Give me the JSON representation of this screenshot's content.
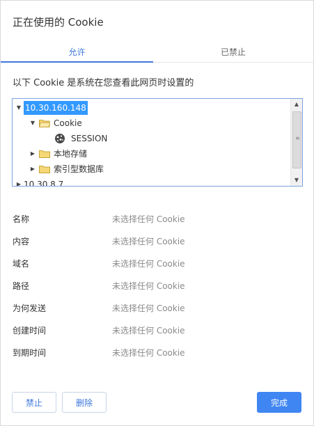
{
  "dialog": {
    "title": "正在使用的 Cookie",
    "tabs": [
      {
        "label": "允许",
        "active": true
      },
      {
        "label": "已禁止",
        "active": false
      }
    ],
    "description": "以下 Cookie 是系统在您查看此网页时设置的",
    "tree": {
      "nodes": [
        {
          "label": "10.30.160.148",
          "expanded": true,
          "selected": true,
          "icon": "none"
        },
        {
          "label": "Cookie",
          "expanded": true,
          "icon": "folder-open-icon"
        },
        {
          "label": "SESSION",
          "icon": "cookie-icon"
        },
        {
          "label": "本地存储",
          "expanded": false,
          "icon": "folder-icon"
        },
        {
          "label": "索引型数据库",
          "expanded": false,
          "icon": "folder-icon"
        },
        {
          "label": "10.30.8.7",
          "expanded": false,
          "icon": "none"
        }
      ]
    },
    "details": [
      {
        "key": "名称",
        "value": "未选择任何 Cookie"
      },
      {
        "key": "内容",
        "value": "未选择任何 Cookie"
      },
      {
        "key": "域名",
        "value": "未选择任何 Cookie"
      },
      {
        "key": "路径",
        "value": "未选择任何 Cookie"
      },
      {
        "key": "为何发送",
        "value": "未选择任何 Cookie"
      },
      {
        "key": "创建时间",
        "value": "未选择任何 Cookie"
      },
      {
        "key": "到期时间",
        "value": "未选择任何 Cookie"
      }
    ],
    "buttons": {
      "block": "禁止",
      "delete": "删除",
      "done": "完成"
    },
    "colors": {
      "accent": "#3f78dc",
      "primary_button": "#3f86f2",
      "selection": "#3399ff"
    }
  }
}
